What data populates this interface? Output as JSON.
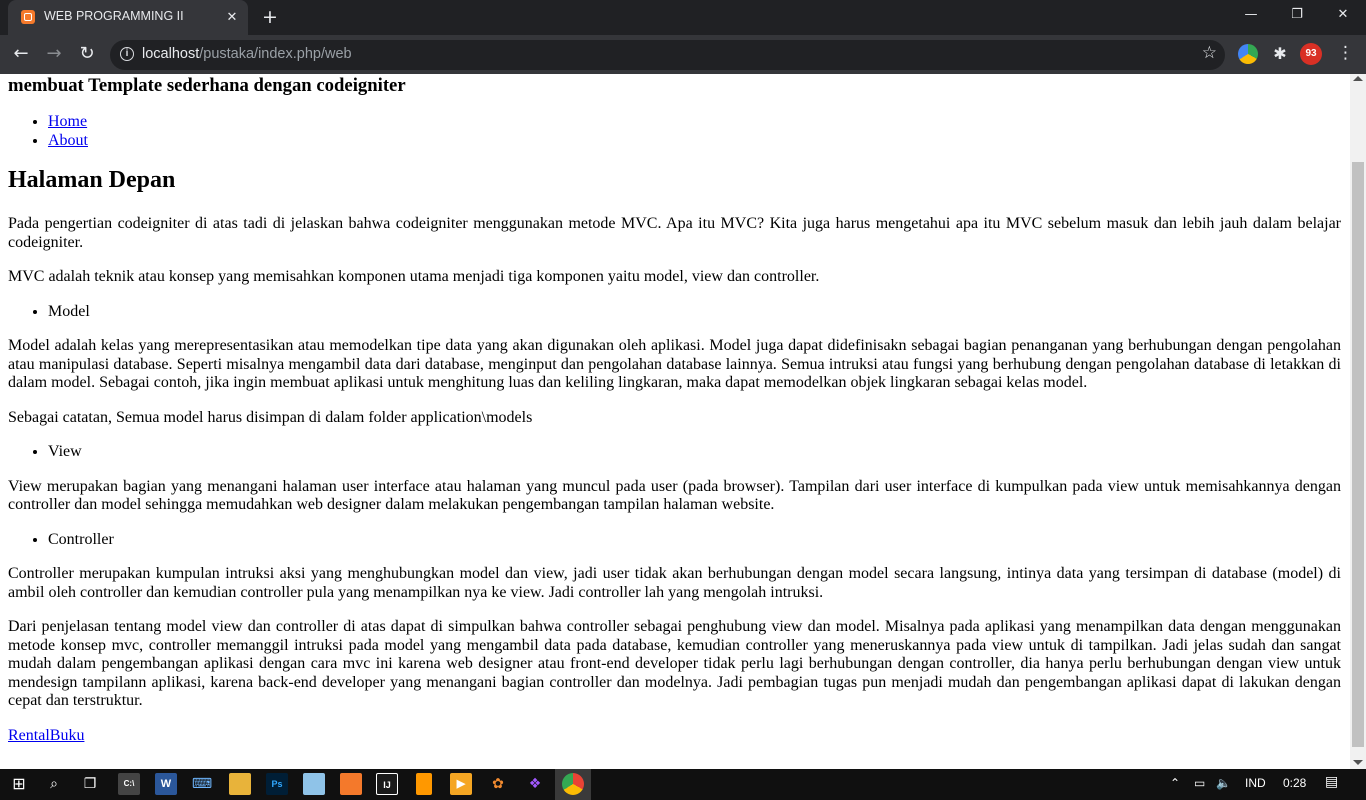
{
  "browser": {
    "tab_title": "WEB PROGRAMMING II",
    "url_host": "localhost",
    "url_path": "/pustaka/index.php/web",
    "tab_close": "✕",
    "new_tab": "+",
    "minimize": "—",
    "maximize": "❐",
    "close": "✕"
  },
  "page": {
    "heading": "membuat Template sederhana dengan codeigniter",
    "nav": [
      "Home",
      "About"
    ],
    "title": "Halaman Depan",
    "intro": "Pada pengertian codeigniter di atas tadi di jelaskan bahwa codeigniter menggunakan metode MVC. Apa itu MVC? Kita juga harus mengetahui apa itu MVC sebelum masuk dan lebih jauh dalam belajar codeigniter.",
    "mvc_def": "MVC adalah teknik atau konsep yang memisahkan komponen utama menjadi tiga komponen yaitu model, view dan controller.",
    "model_label": "Model",
    "model_text": "Model adalah kelas yang merepresentasikan atau memodelkan tipe data yang akan digunakan oleh aplikasi. Model juga dapat didefinisakn sebagai bagian penanganan yang berhubungan dengan pengolahan atau manipulasi database. Seperti misalnya mengambil data dari database, menginput dan pengolahan database lainnya. Semua intruksi atau fungsi yang berhubung dengan pengolahan database di letakkan di dalam model. Sebagai contoh, jika ingin membuat aplikasi untuk menghitung luas dan keliling lingkaran, maka dapat memodelkan objek lingkaran sebagai kelas model.",
    "model_note": "Sebagai catatan, Semua model harus disimpan di dalam folder application\\models",
    "view_label": "View",
    "view_text": "View merupakan bagian yang menangani halaman user interface atau halaman yang muncul pada user (pada browser). Tampilan dari user interface di kumpulkan pada view untuk memisahkannya dengan controller dan model sehingga memudahkan web designer dalam melakukan pengembangan tampilan halaman website.",
    "controller_label": "Controller",
    "controller_text": "Controller merupakan kumpulan intruksi aksi yang menghubungkan model dan view, jadi user tidak akan berhubungan dengan model secara langsung, intinya data yang tersimpan di database (model) di ambil oleh controller dan kemudian controller pula yang menampilkan nya ke view. Jadi controller lah yang mengolah intruksi.",
    "conclusion": "Dari penjelasan tentang model view dan controller di atas dapat di simpulkan bahwa controller sebagai penghubung view dan model. Misalnya pada aplikasi yang menampilkan data dengan menggunakan metode konsep mvc, controller memanggil intruksi pada model yang mengambil data pada database, kemudian controller yang meneruskannya pada view untuk di tampilkan. Jadi jelas sudah dan sangat mudah dalam pengembangan aplikasi dengan cara mvc ini karena web designer atau front-end developer tidak perlu lagi berhubungan dengan controller, dia hanya perlu berhubungan dengan view untuk mendesign tampilann aplikasi, karena back-end developer yang menangani bagian controller dan modelnya. Jadi pembagian tugas pun menjadi mudah dan pengembangan aplikasi dapat di lakukan dengan cepat dan terstruktur.",
    "footer_link": "RentalBuku"
  },
  "taskbar": {
    "ext_badge": "93",
    "lang": "IND",
    "time": "0:28",
    "icons": [
      "windows-start-icon",
      "search-icon",
      "task-view-icon",
      "calculator-icon",
      "word-icon",
      "keyboard-icon",
      "file-explorer-icon",
      "photoshop-icon",
      "notepad-icon",
      "xampp-icon",
      "intellij-icon",
      "sublime-icon",
      "media-player-icon",
      "settings-app-icon",
      "figma-icon",
      "chrome-icon"
    ]
  }
}
